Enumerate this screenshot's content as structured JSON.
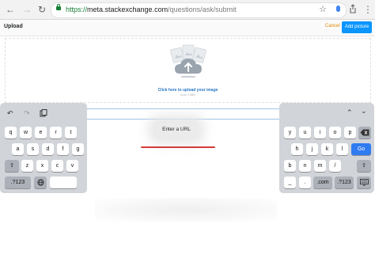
{
  "browser": {
    "url_scheme": "https://",
    "url_host": "meta.stackexchange.com",
    "url_path": "/questions/ask/submit",
    "icons": [
      "back-arrow-icon",
      "forward-arrow-icon",
      "reload-icon",
      "lock-icon",
      "star-icon",
      "mic-icon",
      "share-icon",
      "menu-icon"
    ]
  },
  "modal": {
    "title": "Upload",
    "cancel_label": "Cancel",
    "add_picture_label": "Add picture",
    "accent_color": "#0a95ff",
    "cancel_color": "#e08a00"
  },
  "dropzone": {
    "cta": "Click here to upload your image",
    "note": "(max 2 MiB)"
  },
  "url_popup": {
    "label": "Enter a URL"
  },
  "keyboard": {
    "left_toolbar": [
      "undo-icon",
      "redo-icon",
      "paste-icon"
    ],
    "right_toolbar": [
      "chevron-up-icon",
      "chevron-down-icon"
    ],
    "left_rows": [
      [
        "q",
        "w",
        "e",
        "r",
        "t"
      ],
      [
        "a",
        "s",
        "d",
        "f",
        "g"
      ],
      [
        "z",
        "x",
        "c",
        "v"
      ]
    ],
    "right_rows": [
      [
        "y",
        "u",
        "i",
        "o",
        "p"
      ],
      [
        "h",
        "j",
        "k",
        "l"
      ],
      [
        "b",
        "n",
        "m",
        "/"
      ]
    ],
    "numbers_label": ".?123",
    "go_label": "Go",
    "dot_label": ".",
    "underscore_label": "_",
    "dotcom_label": ".com",
    "go_color": "#2f7bf0"
  }
}
